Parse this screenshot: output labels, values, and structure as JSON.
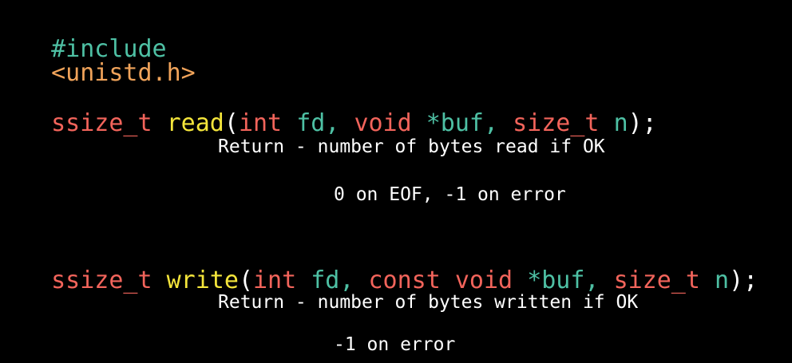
{
  "colors": {
    "background": "#000000",
    "preprocessor": "#4ec0a4",
    "header": "#f0a35a",
    "type": "#f2645b",
    "function": "#f4e53b",
    "identifier": "#4ec0a4",
    "punctuation": "#ffffff",
    "comment": "#ffffff"
  },
  "include": {
    "directive": "#include",
    "header": "<unistd.h>"
  },
  "read": {
    "return_type": "ssize_t",
    "name": "read",
    "open_paren": "(",
    "p1_type": "int",
    "p1_name": "fd,",
    "p2_type": "void",
    "p2_name": "*buf,",
    "p3_type": "size_t",
    "p3_name": "n",
    "close": ");",
    "note_1": "Return - number of bytes read if OK",
    "note_2": "0 on EOF, -1 on error"
  },
  "write": {
    "return_type": "ssize_t",
    "name": "write",
    "open_paren": "(",
    "p1_type": "int",
    "p1_name": "fd,",
    "p2_qualifier": "const",
    "p2_type": "void",
    "p2_name": "*buf,",
    "p3_type": "size_t",
    "p3_name": "n",
    "close": ");",
    "note_1": "Return - number of bytes written if OK",
    "note_2": "-1 on error"
  }
}
